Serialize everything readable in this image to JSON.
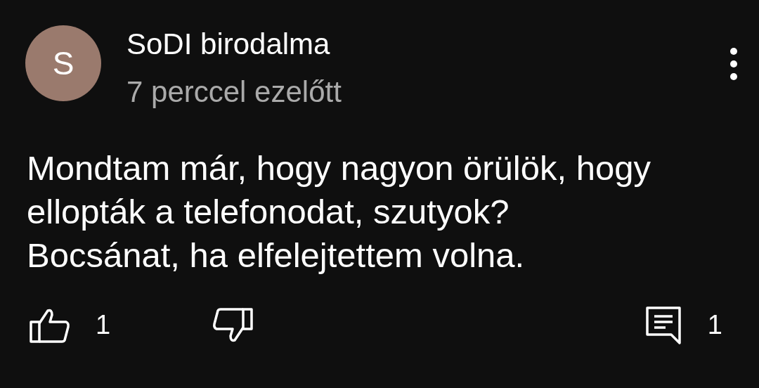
{
  "comment": {
    "avatar_letter": "S",
    "author": "SoDI birodalma",
    "time": "7 perccel ezelőtt",
    "text": "Mondtam már, hogy nagyon örülök, hogy\nellopták a telefonodat, szutyok?\nBocsánat, ha elfelejtettem volna.",
    "likes": "1",
    "replies": "1"
  }
}
